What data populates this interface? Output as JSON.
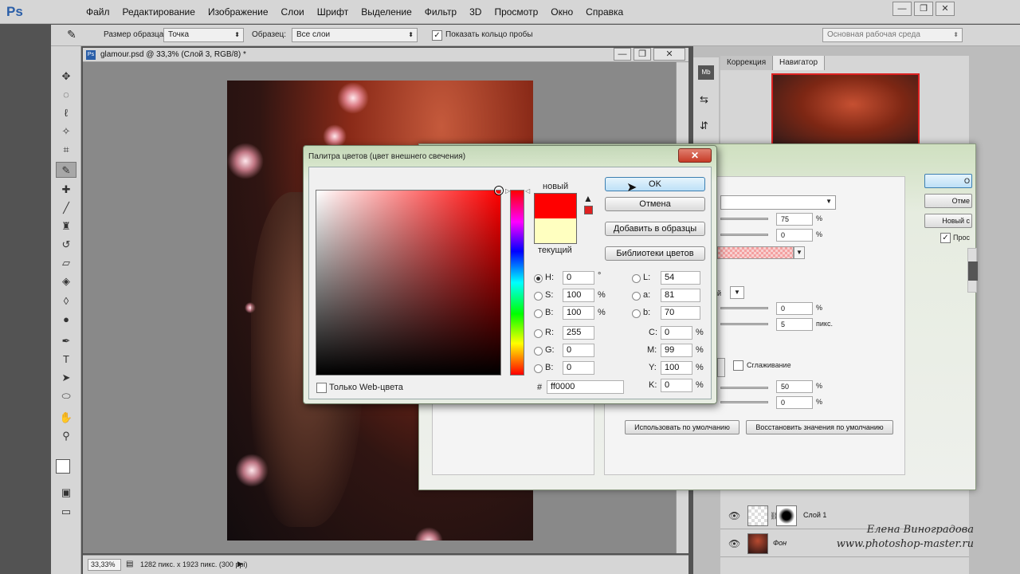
{
  "app": {
    "logo": "Ps",
    "menu": [
      "Файл",
      "Редактирование",
      "Изображение",
      "Слои",
      "Шрифт",
      "Выделение",
      "Фильтр",
      "3D",
      "Просмотр",
      "Окно",
      "Справка"
    ],
    "window_controls": {
      "minimize": "—",
      "restore": "❐",
      "close": "✕"
    }
  },
  "options_bar": {
    "sample_size_label": "Размер образца:",
    "sample_size_value": "Точка",
    "sample_label": "Образец:",
    "sample_value": "Все слои",
    "show_ring_label": "Показать кольцо пробы",
    "show_ring_checked": true,
    "workspace_value": "Основная рабочая среда"
  },
  "document": {
    "tab_title": "glamour.psd @ 33,3% (Слой 3, RGB/8) *",
    "zoom": "33,33%",
    "info": "1282 пикс. x 1923 пикс. (300 ppi)"
  },
  "right_panel": {
    "tabs": [
      "Коррекция",
      "Навигатор"
    ],
    "active_tab": "Навигатор",
    "strip_icons": [
      "Mb",
      "⇆",
      "⇵"
    ]
  },
  "layers": [
    {
      "name": "Слой 1"
    },
    {
      "name": "Фон"
    }
  ],
  "layer_style": {
    "value_75": "75",
    "value_0a": "0",
    "value_0b": "0",
    "value_5": "5",
    "px_unit": "пикс.",
    "pct": "%",
    "antialias_label": "Сглаживание",
    "value_50": "50",
    "value_0c": "0",
    "default_btn": "Использовать по умолчанию",
    "restore_btn": "Восстановить значения по умолчанию",
    "right_btn_1": "О",
    "right_btn_2": "Отме",
    "right_btn_3": "Новый с",
    "preview_label": "Прос",
    "contour_label": "й"
  },
  "picker": {
    "title": "Палитра цветов (цвет внешнего свечения)",
    "new_label": "новый",
    "current_label": "текущий",
    "new_color": "#ff0000",
    "current_color": "#ffffc0",
    "ok": "OK",
    "cancel": "Отмена",
    "add_swatch": "Добавить в образцы",
    "libraries": "Библиотеки цветов",
    "web_only": "Только Web-цвета",
    "hsb": [
      {
        "label": "H:",
        "value": "0",
        "unit": "°"
      },
      {
        "label": "S:",
        "value": "100",
        "unit": "%"
      },
      {
        "label": "B:",
        "value": "100",
        "unit": "%"
      }
    ],
    "rgb": [
      {
        "label": "R:",
        "value": "255"
      },
      {
        "label": "G:",
        "value": "0"
      },
      {
        "label": "B:",
        "value": "0"
      }
    ],
    "lab": [
      {
        "label": "L:",
        "value": "54"
      },
      {
        "label": "a:",
        "value": "81"
      },
      {
        "label": "b:",
        "value": "70"
      }
    ],
    "cmyk": [
      {
        "label": "C:",
        "value": "0",
        "unit": "%"
      },
      {
        "label": "M:",
        "value": "99",
        "unit": "%"
      },
      {
        "label": "Y:",
        "value": "100",
        "unit": "%"
      },
      {
        "label": "K:",
        "value": "0",
        "unit": "%"
      }
    ],
    "hex_label": "#",
    "hex": "ff0000"
  },
  "watermark": {
    "line1": "Елена Виноградова",
    "line2": "www.photoshop-master.ru"
  }
}
